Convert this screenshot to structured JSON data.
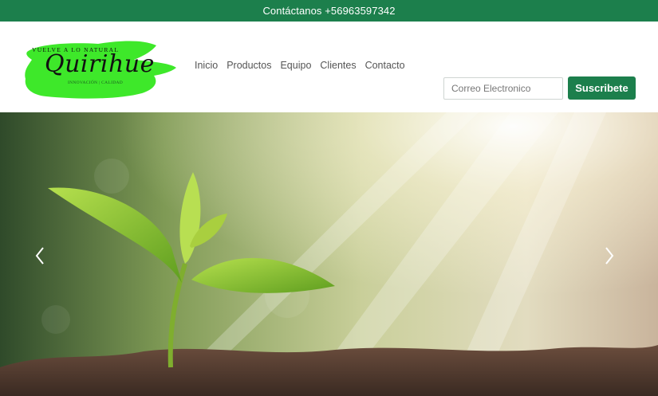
{
  "topbar": {
    "contact_text": "Contáctanos +56963597342"
  },
  "logo": {
    "tagline": "VUELVE A LO NATURAL",
    "brand": "Quirihue",
    "subtag": "INNOVACIÓN | CALIDAD"
  },
  "nav": {
    "items": [
      "Inicio",
      "Productos",
      "Equipo",
      "Clientes",
      "Contacto"
    ]
  },
  "subscribe": {
    "placeholder": "Correo Electronico",
    "button_label": "Suscribete"
  },
  "hero": {
    "image_subject": "seedling sprouting from soil with sun rays",
    "prev_icon": "chevron-left-icon",
    "next_icon": "chevron-right-icon"
  },
  "colors": {
    "brand_green": "#1c7f4c",
    "logo_green": "#3ee82a"
  }
}
